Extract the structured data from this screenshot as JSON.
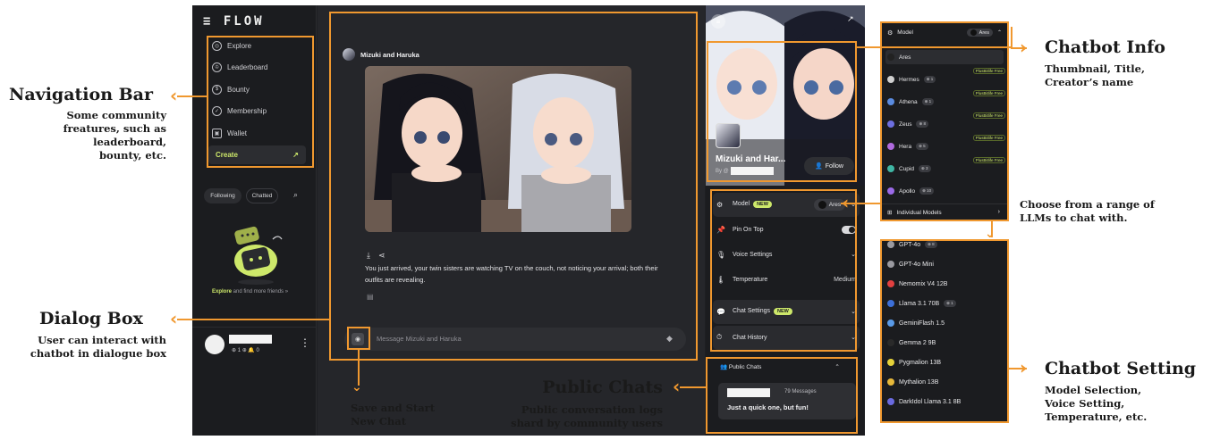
{
  "app": {
    "logo": "≡ FLOW",
    "nav": [
      {
        "label": "Explore",
        "icon": "compass-icon",
        "glyph": "◎"
      },
      {
        "label": "Leaderboard",
        "icon": "medal-icon",
        "glyph": "♔"
      },
      {
        "label": "Bounty",
        "icon": "dollar-icon",
        "glyph": "$"
      },
      {
        "label": "Membership",
        "icon": "badge-icon",
        "glyph": "✓"
      },
      {
        "label": "Wallet",
        "icon": "wallet-icon",
        "glyph": "▣"
      }
    ],
    "create_label": "Create",
    "tabs": {
      "following": "Following",
      "chatted": "Chatted"
    },
    "explore_more": {
      "link": "Explore",
      "rest": " and find more friends »"
    },
    "user_stats": "⊕ 1  ⊕   🔔 0"
  },
  "chat": {
    "title": "Mizuki and Haruka",
    "message": "You just arrived, your twin sisters are watching TV on the couch, not noticing your arrival; both their outfits are revealing.",
    "input_placeholder": "Message Mizuki and Haruka"
  },
  "bot": {
    "name": "Mizuki and Har...",
    "by": "By @",
    "follow_label": "Follow"
  },
  "settings": {
    "model_label": "Model",
    "new_badge": "NEW",
    "model_value": "Ares",
    "pin_label": "Pin On Top",
    "voice_label": "Voice Settings",
    "temp_label": "Temperature",
    "temp_value": "Medium",
    "chat_settings_label": "Chat Settings",
    "history_label": "Chat History"
  },
  "public": {
    "title": "Public Chats",
    "count": "79 Messages",
    "snippet": "Just a quick one, but fun!"
  },
  "model_picker": {
    "header": "Model",
    "selected": "Ares",
    "badge": "PlusBitlife Free",
    "models": [
      {
        "name": "Ares",
        "count": "",
        "color": "#222222"
      },
      {
        "name": "Hermes",
        "count": "⊕ 1",
        "color": "#d0d0d0"
      },
      {
        "name": "Athena",
        "count": "⊕ 1",
        "color": "#5a8be0"
      },
      {
        "name": "Zeus",
        "count": "⊕ 8",
        "color": "#6d6fe0"
      },
      {
        "name": "Hera",
        "count": "⊕ 5",
        "color": "#b06adf"
      },
      {
        "name": "Cupid",
        "count": "⊕ 3",
        "color": "#3fb6a4"
      },
      {
        "name": "Apollo",
        "count": "⊕ 10",
        "color": "#9b6ae8"
      }
    ],
    "individual_label": "Individual Models"
  },
  "llm_list": [
    {
      "name": "GPT-4o",
      "count": "⊕ 8",
      "color": "#9a9aa0"
    },
    {
      "name": "GPT-4o Mini",
      "count": "",
      "color": "#9a9aa0"
    },
    {
      "name": "Nemomix V4 12B",
      "count": "",
      "color": "#e24040"
    },
    {
      "name": "Llama 3.1 70B",
      "count": "⊕ 1",
      "color": "#3c6fd8"
    },
    {
      "name": "GeminiFlash 1.5",
      "count": "",
      "color": "#5a9be8"
    },
    {
      "name": "Gemma 2 9B",
      "count": "",
      "color": "#2a2a2a"
    },
    {
      "name": "Pygmalion 13B",
      "count": "",
      "color": "#e6d23a"
    },
    {
      "name": "Mythalion 13B",
      "count": "",
      "color": "#e6b83a"
    },
    {
      "name": "DarkIdol Llama 3.1 8B",
      "count": "",
      "color": "#6a6ae0"
    }
  ],
  "annotations": {
    "nav_title": "Navigation Bar",
    "nav_desc": [
      "Some community",
      "freatures, such as",
      "leaderboard,",
      "bounty, etc."
    ],
    "dialog_title": "Dialog Box",
    "dialog_desc": [
      "User can interact with",
      "chatbot in dialogue box"
    ],
    "save_desc": [
      "Save and Start",
      "New Chat"
    ],
    "public_title": "Public Chats",
    "public_desc": [
      "Public conversation logs",
      "shard by community users"
    ],
    "info_title": "Chatbot  Info",
    "info_desc": [
      "Thumbnail, Title,",
      "Creator’s name"
    ],
    "llm_desc": [
      "Choose from a range of",
      "LLMs to chat with."
    ],
    "setting_title": "Chatbot Setting",
    "setting_desc": [
      "Model Selection,",
      "Voice Setting,",
      "Temperature, etc."
    ]
  },
  "colors": {
    "accent": "#f0982f",
    "lime": "#cde86a",
    "dark": "#1b1c1f"
  }
}
